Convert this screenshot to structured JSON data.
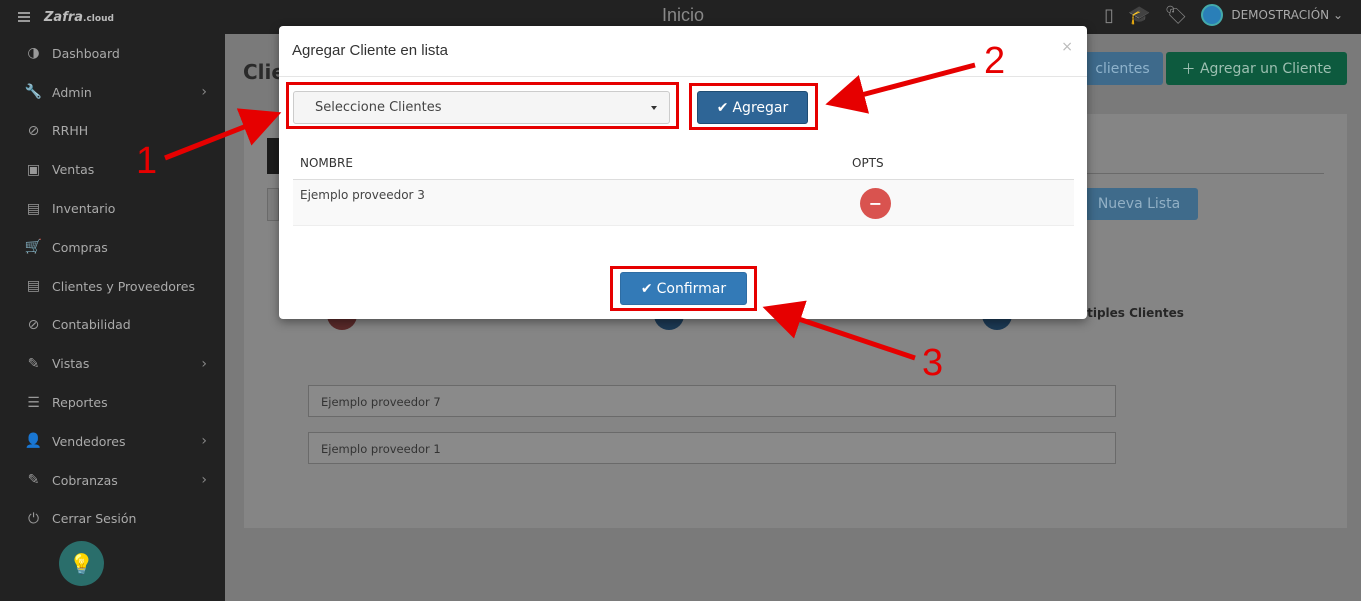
{
  "sidebar": {
    "logo_text": "Zafra",
    "logo_suffix": ".cloud",
    "items": [
      {
        "label": "Dashboard",
        "icon": "dashboard-icon",
        "glyph": "◑",
        "has_chevron": false
      },
      {
        "label": "Admin",
        "icon": "wrench-icon",
        "glyph": "🔧",
        "has_chevron": true
      },
      {
        "label": "RRHH",
        "icon": "paperclip-icon",
        "glyph": "⊘",
        "has_chevron": false
      },
      {
        "label": "Ventas",
        "icon": "money-icon",
        "glyph": "▣",
        "has_chevron": false
      },
      {
        "label": "Inventario",
        "icon": "book-icon",
        "glyph": "▤",
        "has_chevron": false
      },
      {
        "label": "Compras",
        "icon": "cart-icon",
        "glyph": "🛒",
        "has_chevron": false
      },
      {
        "label": "Clientes y Proveedores",
        "icon": "book-icon",
        "glyph": "▤",
        "has_chevron": false
      },
      {
        "label": "Contabilidad",
        "icon": "paperclip-icon",
        "glyph": "⊘",
        "has_chevron": false
      },
      {
        "label": "Vistas",
        "icon": "edit-icon",
        "glyph": "✎",
        "has_chevron": true
      },
      {
        "label": "Reportes",
        "icon": "list-icon",
        "glyph": "☰",
        "has_chevron": false
      },
      {
        "label": "Vendedores",
        "icon": "user-icon",
        "glyph": "👤",
        "has_chevron": true
      },
      {
        "label": "Cobranzas",
        "icon": "edit-icon",
        "glyph": "✎",
        "has_chevron": true
      },
      {
        "label": "Cerrar Sesión",
        "icon": "power-icon",
        "glyph": "⏻",
        "has_chevron": false
      }
    ]
  },
  "topbar": {
    "title": "Inicio",
    "user_name": "DEMOSTRACIÓN"
  },
  "background": {
    "page_title": "Clie",
    "btn_clients": "clientes",
    "btn_add_client": "Agregar un Cliente",
    "btn_new_list": "Nueva Lista",
    "multi_label": "ltiples Clientes",
    "fields": [
      "Ejemplo proveedor 7",
      "Ejemplo proveedor 1"
    ]
  },
  "modal": {
    "title": "Agregar Cliente en lista",
    "close": "×",
    "select_value": "Seleccione Clientes",
    "btn_add": "Agregar",
    "col_name": "NOMBRE",
    "col_opts": "OPTS",
    "rows": [
      {
        "name": "Ejemplo proveedor 3"
      }
    ],
    "btn_confirm": "Confirmar"
  },
  "annotations": {
    "n1": "1",
    "n2": "2",
    "n3": "3",
    "color": "#e60000"
  },
  "colors": {
    "primary_button": "#337ab7",
    "danger": "#d9534f",
    "sidebar_bg": "#222222"
  }
}
